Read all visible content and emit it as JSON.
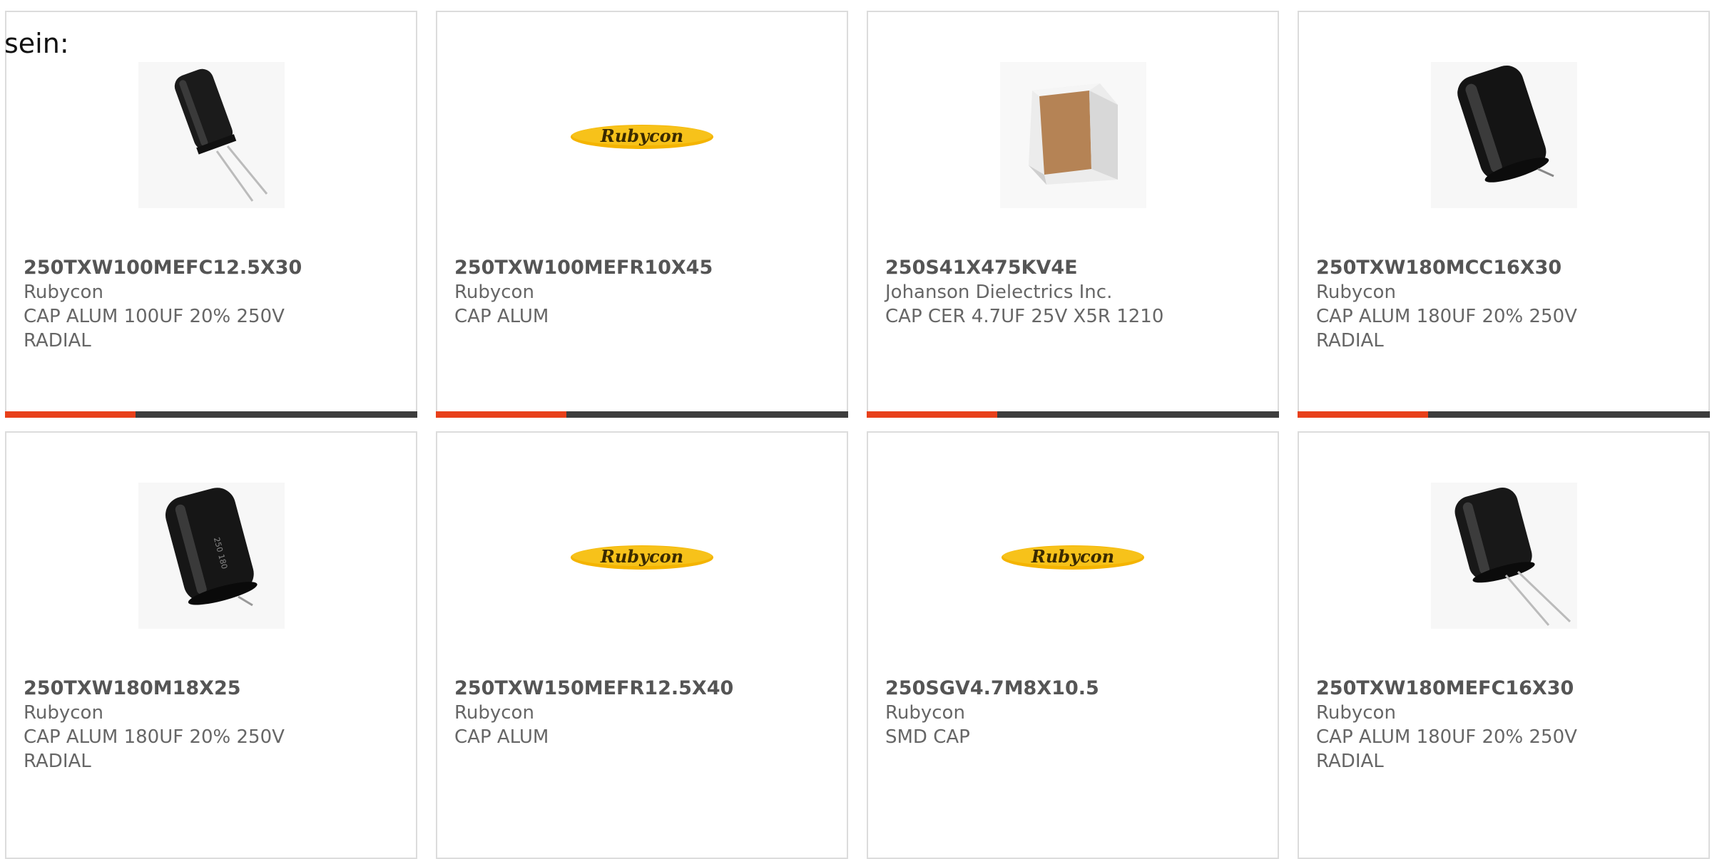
{
  "intro_text": "sein:",
  "colors": {
    "accent": "#e8401a",
    "bar": "#3d3d3d",
    "border": "#dcdcdc",
    "rubycon_logo_yellow": "#f4b400",
    "rubycon_logo_text": "#3a2a00"
  },
  "cards": [
    {
      "part_number": "250TXW100MEFC12.5X30",
      "manufacturer": "Rubycon",
      "desc_line1": "CAP ALUM 100UF 20% 250V",
      "desc_line2": "RADIAL",
      "image": "radial-capacitor-small-image"
    },
    {
      "part_number": "250TXW100MEFR10X45",
      "manufacturer": "Rubycon",
      "desc_line1": "CAP ALUM",
      "desc_line2": "",
      "image": "rubycon-logo",
      "logo_text": "Rubycon"
    },
    {
      "part_number": "250S41X475KV4E",
      "manufacturer": "Johanson Dielectrics Inc.",
      "desc_line1": "CAP CER 4.7UF 25V X5R 1210",
      "desc_line2": "",
      "image": "ceramic-chip-capacitor-image"
    },
    {
      "part_number": "250TXW180MCC16X30",
      "manufacturer": "Rubycon",
      "desc_line1": "CAP ALUM 180UF 20% 250V",
      "desc_line2": "RADIAL",
      "image": "radial-capacitor-large-image"
    },
    {
      "part_number": "250TXW180M18X25",
      "manufacturer": "Rubycon",
      "desc_line1": "CAP ALUM 180UF 20% 250V",
      "desc_line2": "RADIAL",
      "image": "radial-capacitor-large-image"
    },
    {
      "part_number": "250TXW150MEFR12.5X40",
      "manufacturer": "Rubycon",
      "desc_line1": "CAP ALUM",
      "desc_line2": "",
      "image": "rubycon-logo",
      "logo_text": "Rubycon"
    },
    {
      "part_number": "250SGV4.7M8X10.5",
      "manufacturer": "Rubycon",
      "desc_line1": "SMD CAP",
      "desc_line2": "",
      "image": "rubycon-logo",
      "logo_text": "Rubycon"
    },
    {
      "part_number": "250TXW180MEFC16X30",
      "manufacturer": "Rubycon",
      "desc_line1": "CAP ALUM 180UF 20% 250V",
      "desc_line2": "RADIAL",
      "image": "radial-capacitor-small-image"
    }
  ]
}
